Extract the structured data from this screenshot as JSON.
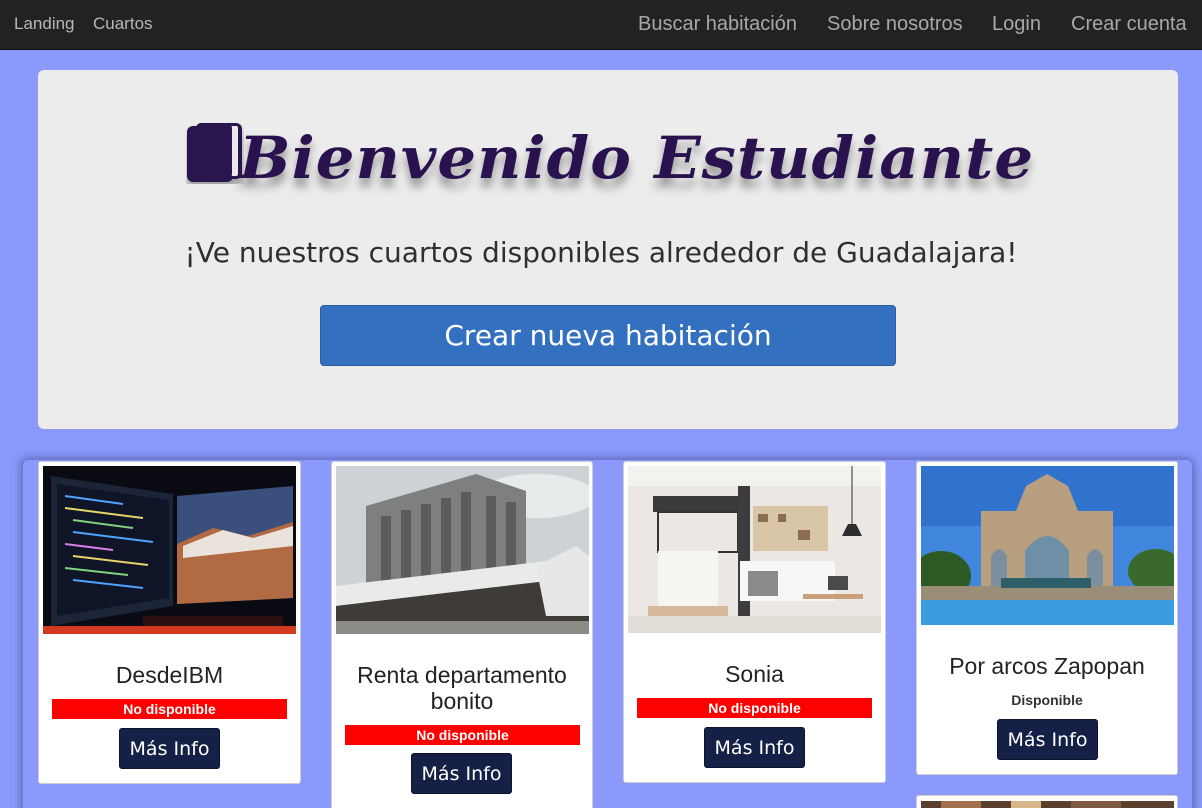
{
  "nav": {
    "landing": "Landing",
    "cuartos": "Cuartos",
    "buscar": "Buscar habitación",
    "sobre": "Sobre nosotros",
    "login": "Login",
    "crear_cuenta": "Crear cuenta"
  },
  "hero": {
    "icon": "book-icon",
    "title": "Bienvenido Estudiante",
    "subtitle": "¡Ve nuestros cuartos disponibles alrededor de Guadalajara!",
    "create_button": "Crear nueva habitación"
  },
  "colors": {
    "background": "#8a99fb",
    "navbar": "#222222",
    "title": "#2a124f",
    "primary_button": "#3470c0",
    "info_button": "#152046",
    "unavailable": "#fd0000"
  },
  "cards": [
    {
      "title": "DesdeIBM",
      "status": "No disponible",
      "button": "Más Info",
      "image": "computer-monitor-photo"
    },
    {
      "title": "Renta departamento bonito",
      "status": "No disponible",
      "button": "Más Info",
      "image": "university-building-photo"
    },
    {
      "title": "Sonia",
      "status": "No disponible",
      "button": "Más Info",
      "image": "kitchen-photo"
    },
    {
      "title": "Por arcos Zapopan",
      "status": "Disponible",
      "button": "Más Info",
      "image": "arch-fountain-photo"
    }
  ]
}
